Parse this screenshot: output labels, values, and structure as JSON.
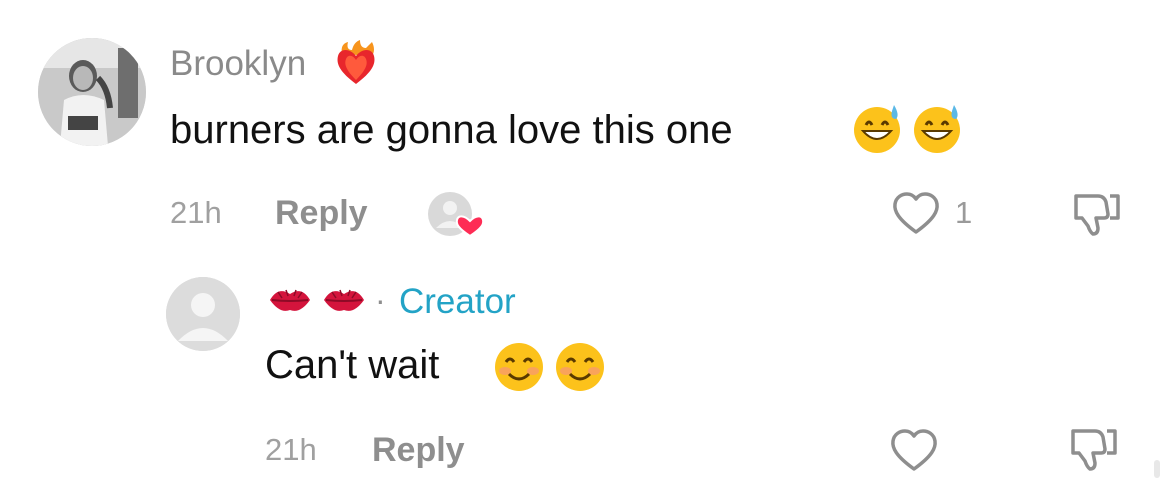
{
  "comments": [
    {
      "username": "Brooklyn",
      "username_emoji": "heart-on-fire-icon",
      "text": "burners are gonna love this one",
      "text_emojis": [
        "grinning-sweat-emoji",
        "grinning-sweat-emoji"
      ],
      "time": "21h",
      "reply_label": "Reply",
      "liked_by_creator": true,
      "like_count": "1"
    },
    {
      "username_emojis": [
        "kiss-mark-icon",
        "kiss-mark-icon"
      ],
      "separator": "·",
      "badge": "Creator",
      "text": "Can't wait",
      "text_emojis": [
        "smiling-blush-emoji",
        "smiling-blush-emoji"
      ],
      "time": "21h",
      "reply_label": "Reply"
    }
  ],
  "colors": {
    "creator_badge": "#23a3c6",
    "muted_text": "#8e8e8e",
    "liked_heart": "#fe2c55"
  }
}
